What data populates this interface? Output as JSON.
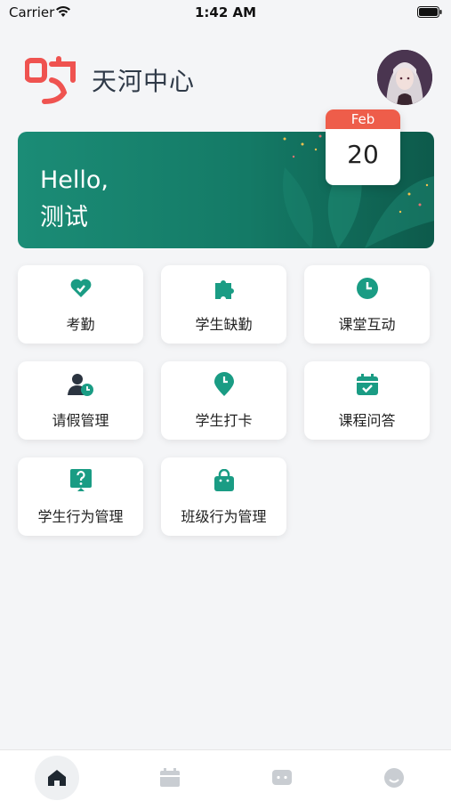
{
  "status_bar": {
    "carrier": "Carrier",
    "time": "1:42 AM"
  },
  "header": {
    "brand": "天河中心",
    "logo_icon": "brand-logo",
    "avatar_icon": "user-avatar"
  },
  "banner": {
    "greeting_line1": "Hello,",
    "greeting_line2": "测试"
  },
  "calendar": {
    "month": "Feb",
    "day": "20"
  },
  "menu": [
    {
      "label": "考勤",
      "icon": "heart-check-icon"
    },
    {
      "label": "学生缺勤",
      "icon": "puzzle-icon"
    },
    {
      "label": "课堂互动",
      "icon": "clock-icon"
    },
    {
      "label": "请假管理",
      "icon": "user-clock-icon"
    },
    {
      "label": "学生打卡",
      "icon": "location-clock-icon"
    },
    {
      "label": "课程问答",
      "icon": "calendar-check-icon"
    },
    {
      "label": "学生行为管理",
      "icon": "question-board-icon"
    },
    {
      "label": "班级行为管理",
      "icon": "bag-icon"
    }
  ],
  "tabbar": [
    "home-icon",
    "calendar-icon",
    "message-icon",
    "profile-icon"
  ],
  "colors": {
    "accent": "#1a9c84",
    "banner": "#157c68",
    "calendar_header": "#ee5d4a",
    "logo": "#ef5350"
  }
}
